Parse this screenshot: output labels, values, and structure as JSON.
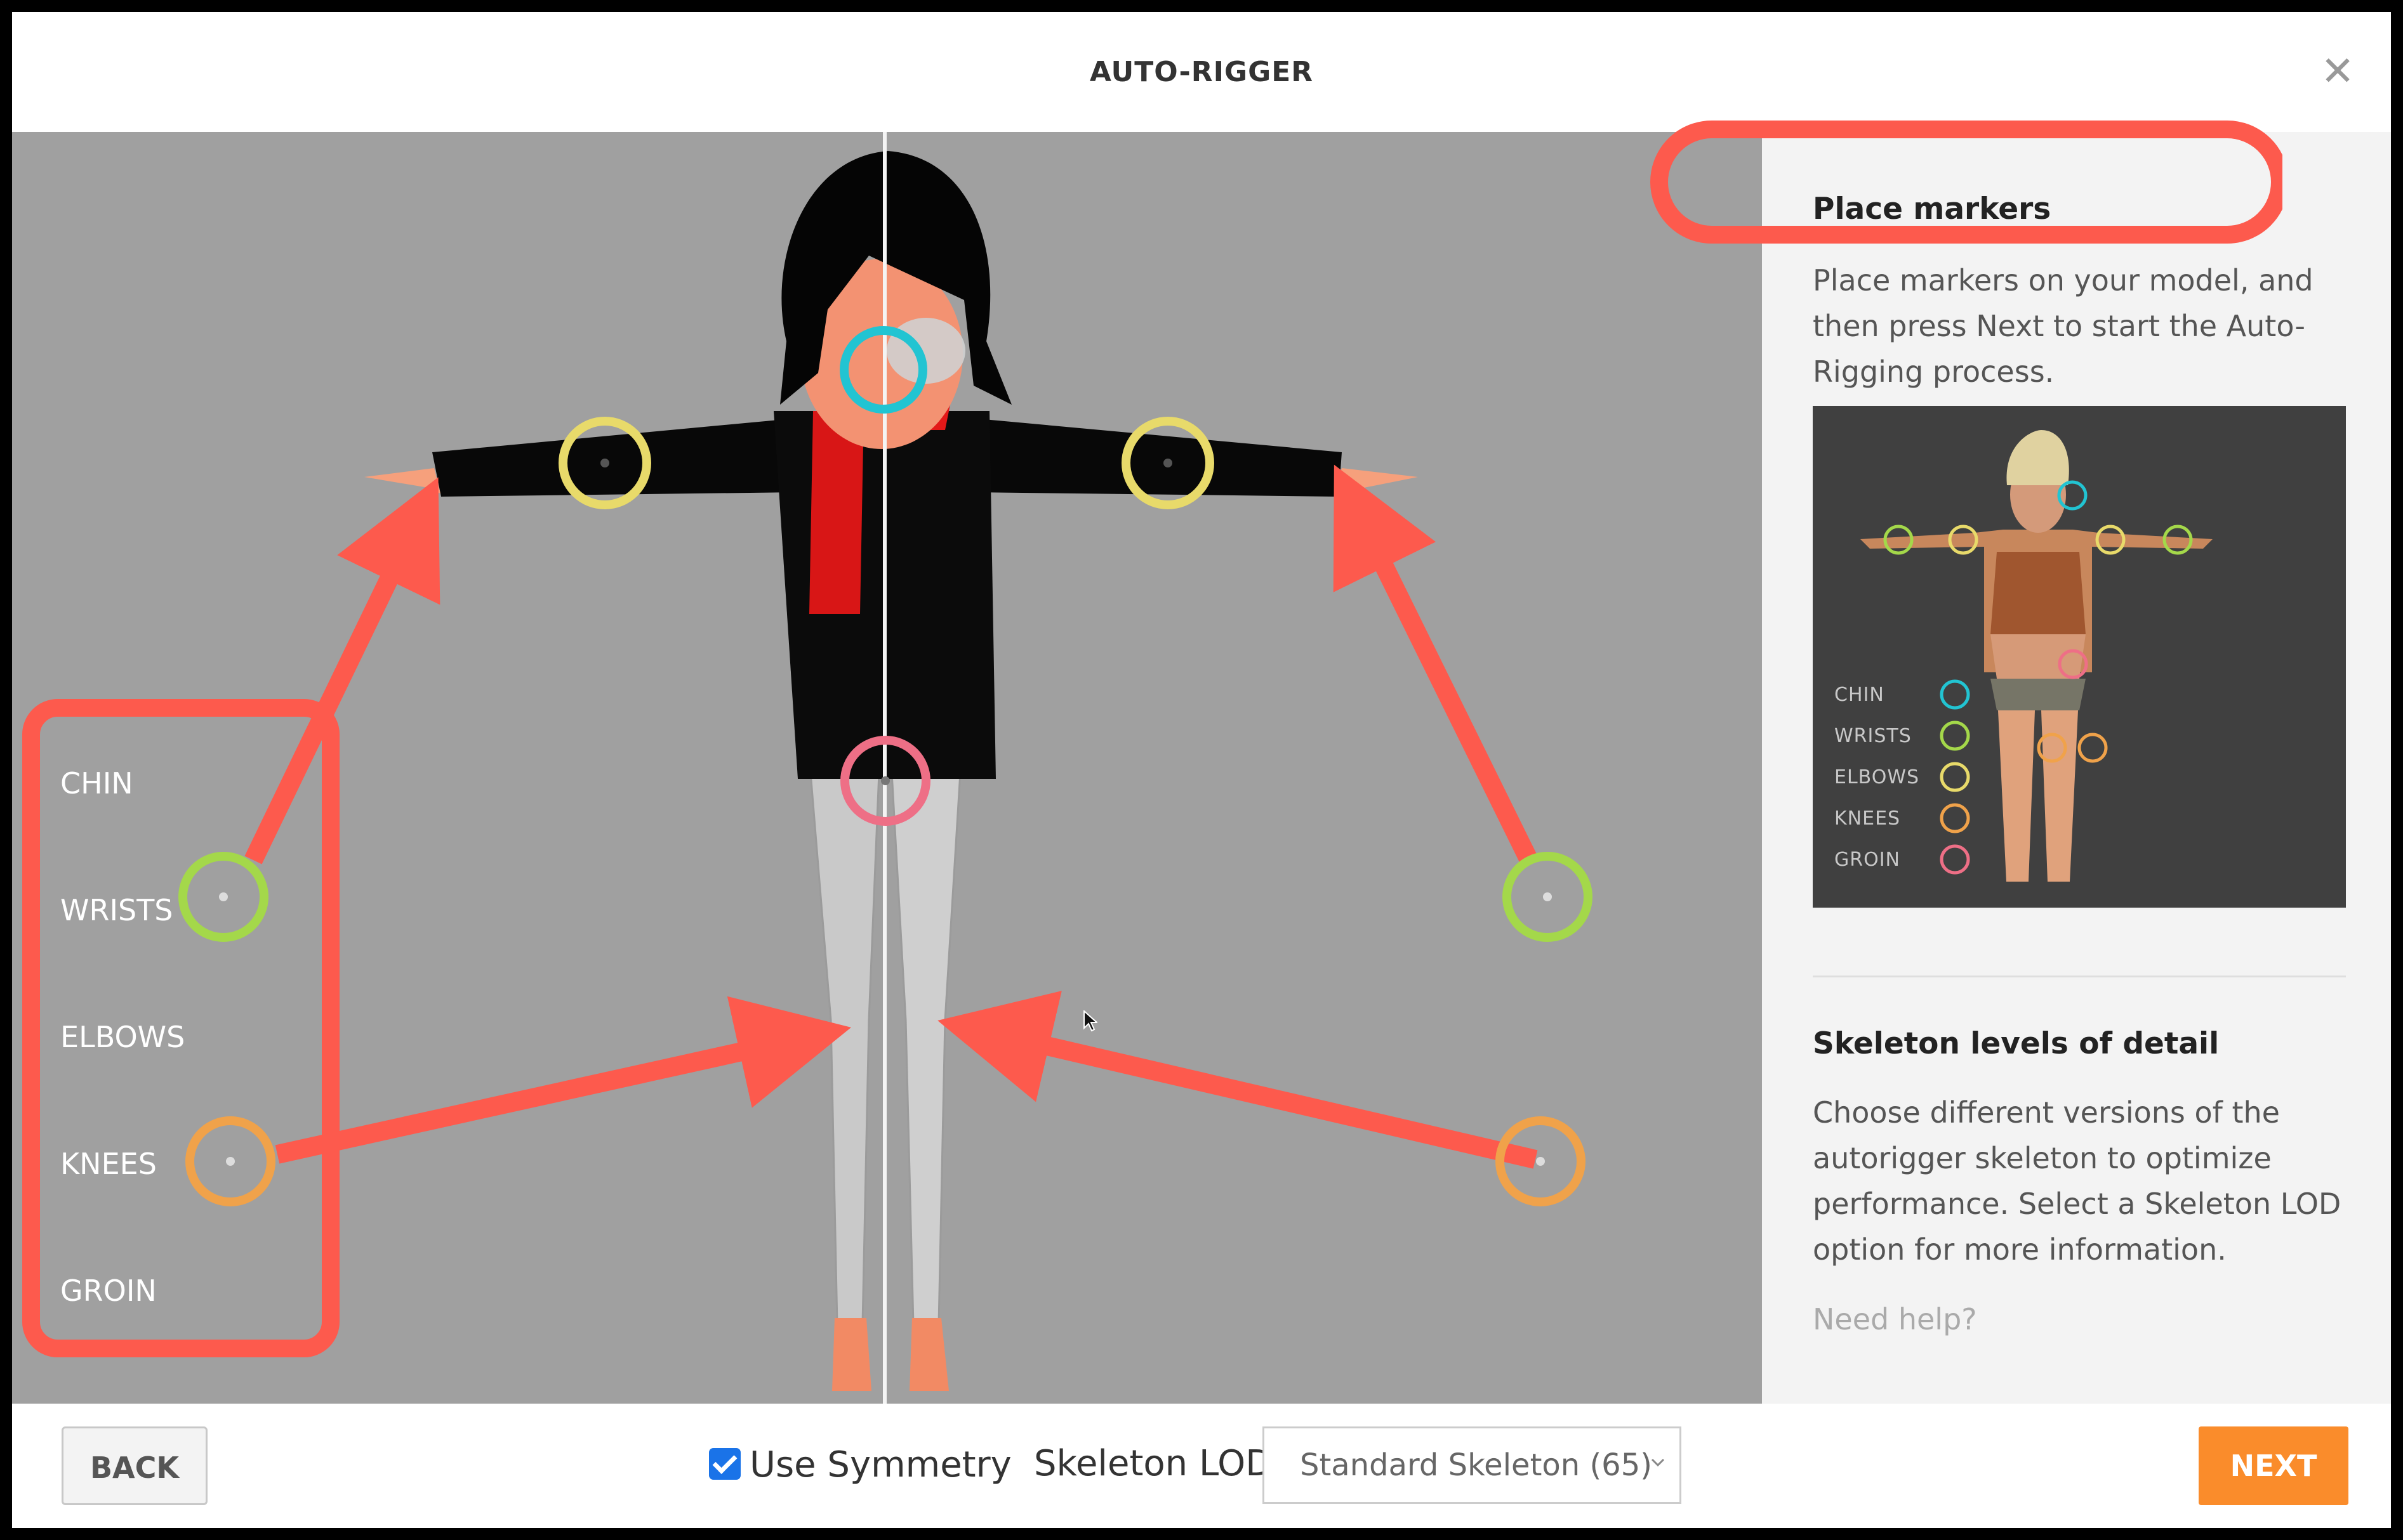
{
  "dialog": {
    "title": "AUTO-RIGGER",
    "close_icon": "close-icon"
  },
  "viewport": {
    "marker_labels": [
      "CHIN",
      "WRISTS",
      "ELBOWS",
      "KNEES",
      "GROIN"
    ],
    "marker_colors": {
      "chin": "#22c4d2",
      "wrists": "#a4d84a",
      "elbows": "#e8da6a",
      "knees": "#f0a24a",
      "groin": "#ee6f86"
    },
    "annotation_color": "#fd5a4d"
  },
  "sidebar": {
    "place_title": "Place markers",
    "place_text": "Place markers on your model, and then press Next to start the Auto-Rigging process.",
    "legend": [
      "CHIN",
      "WRISTS",
      "ELBOWS",
      "KNEES",
      "GROIN"
    ],
    "lod_title": "Skeleton levels of detail",
    "lod_text": "Choose different versions of the autorigger skeleton to optimize performance. Select a Skeleton LOD option for more information.",
    "help_link": "Need help?"
  },
  "footer": {
    "back_label": "BACK",
    "symmetry_label": "Use Symmetry",
    "symmetry_checked": true,
    "lod_label": "Skeleton LOD",
    "lod_value": "Standard Skeleton (65)",
    "next_label": "NEXT"
  }
}
